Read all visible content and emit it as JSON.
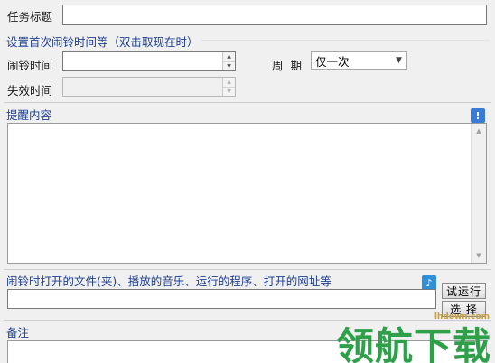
{
  "task": {
    "title_label": "任务标题",
    "title_value": ""
  },
  "schedule": {
    "section_label": "设置首次闹铃时间等（双击取现在时）",
    "alarm_time_label": "闹铃时间",
    "alarm_time_value": "",
    "expire_time_label": "失效时间",
    "expire_time_value": "",
    "period_label": "周  期",
    "period_selected": "仅一次"
  },
  "reminder": {
    "section_label": "提醒内容",
    "content": ""
  },
  "open_target": {
    "section_label": "闹铃时打开的文件(夹)、播放的音乐、运行的程序、打开的网址等",
    "path_value": "",
    "test_run_label": "试运行",
    "choose_label": "选  择"
  },
  "notes": {
    "section_label": "备注",
    "content": ""
  },
  "watermark": {
    "text": "领航下载",
    "url": "lhdown.com"
  },
  "colors": {
    "section_text": "#1f3f8f",
    "watermark_green": "#2ea04a"
  }
}
